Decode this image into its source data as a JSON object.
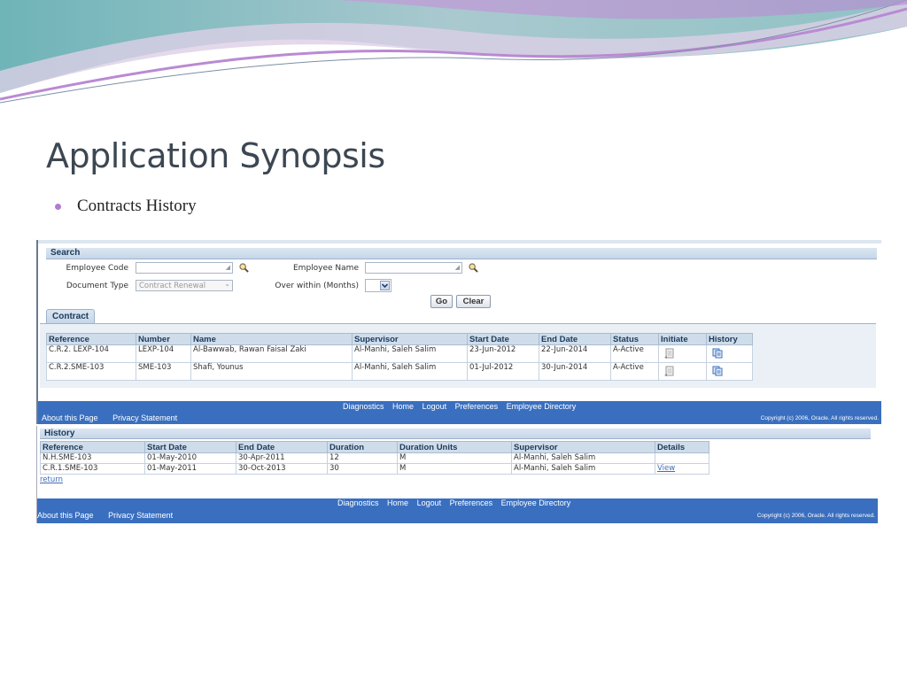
{
  "slide": {
    "title": "Application Synopsis",
    "bullet": "Contracts History"
  },
  "search": {
    "section_title": "Search",
    "employee_code_label": "Employee Code",
    "employee_code_value": "",
    "employee_name_label": "Employee Name",
    "employee_name_value": "",
    "document_type_label": "Document Type",
    "document_type_value": "Contract Renewal",
    "over_within_label": "Over within (Months)",
    "over_within_value": "",
    "go_label": "Go",
    "clear_label": "Clear"
  },
  "contract": {
    "tab_label": "Contract",
    "columns": [
      "Reference",
      "Number",
      "Name",
      "Supervisor",
      "Start Date",
      "End Date",
      "Status",
      "Initiate",
      "History"
    ],
    "rows": [
      {
        "reference": "C.R.2. LEXP-104",
        "number": "LEXP-104",
        "name": "Al-Bawwab, Rawan Faisal Zaki",
        "supervisor": "Al-Manhi, Saleh Salim",
        "start": "23-Jun-2012",
        "end": "22-Jun-2014",
        "status": "A-Active"
      },
      {
        "reference": "C.R.2.SME-103",
        "number": "SME-103",
        "name": "Shafi, Younus",
        "supervisor": "Al-Manhi, Saleh Salim",
        "start": "01-Jul-2012",
        "end": "30-Jun-2014",
        "status": "A-Active"
      }
    ]
  },
  "footer": {
    "links": [
      "Diagnostics",
      "Home",
      "Logout",
      "Preferences",
      "Employee Directory"
    ],
    "about": "About this Page",
    "privacy": "Privacy Statement",
    "copyright": "Copyright (c) 2006, Oracle. All rights reserved."
  },
  "history": {
    "section_title": "History",
    "columns": [
      "Reference",
      "Start Date",
      "End Date",
      "Duration",
      "Duration Units",
      "Supervisor",
      "Details"
    ],
    "rows": [
      {
        "reference": "N.H.SME-103",
        "start": "01-May-2010",
        "end": "30-Apr-2011",
        "duration": "12",
        "units": "M",
        "supervisor": "Al-Manhi, Saleh Salim",
        "details": ""
      },
      {
        "reference": "C.R.1.SME-103",
        "start": "01-May-2011",
        "end": "30-Oct-2013",
        "duration": "30",
        "units": "M",
        "supervisor": "Al-Manhi, Saleh Salim",
        "details": "View"
      }
    ],
    "return_label": "return"
  }
}
